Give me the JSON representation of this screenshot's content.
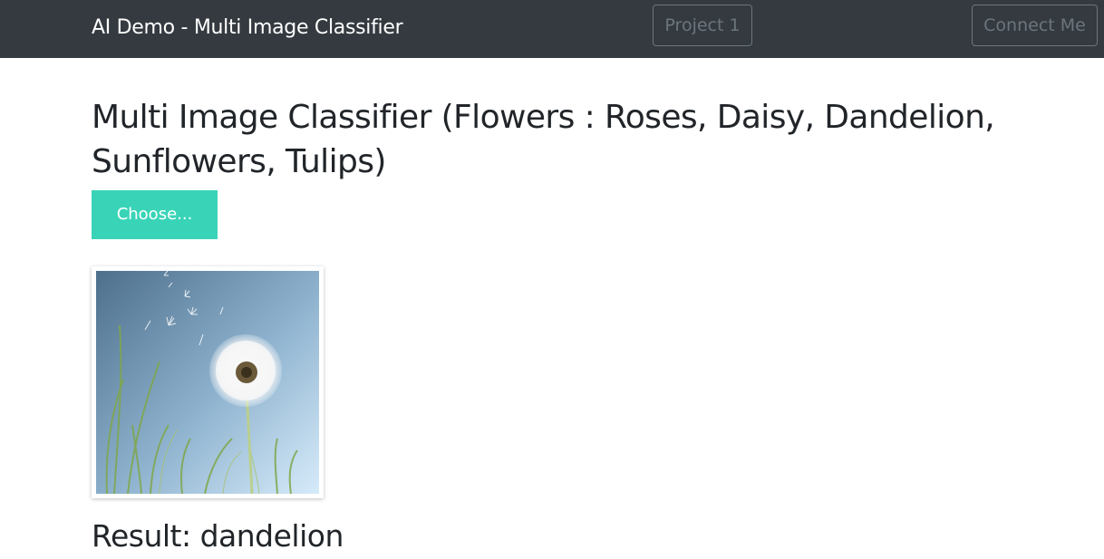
{
  "navbar": {
    "brand": "AI Demo - Multi Image Classifier",
    "buttons": [
      {
        "label": "Project 1"
      },
      {
        "label": "Connect Me"
      }
    ],
    "background_color": "#343a40"
  },
  "main": {
    "title": "Multi Image Classifier (Flowers : Roses, Daisy, Dandelion, Sunflowers, Tulips)",
    "choose_button": {
      "label": "Choose...",
      "color": "#39d4b7"
    },
    "preview_image": {
      "subject": "dandelion-photo"
    },
    "result": {
      "label": "Result:",
      "value": "dandelion"
    }
  }
}
